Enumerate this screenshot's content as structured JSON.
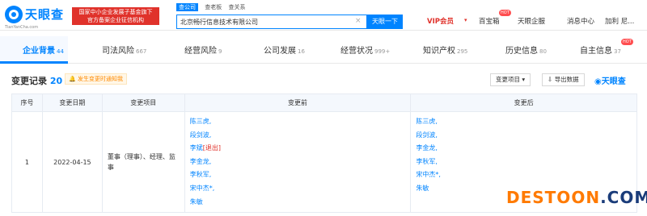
{
  "header": {
    "logo_text": "天眼查",
    "logo_sub": "TianYanCha.com",
    "banner_line1": "国家中小企业发展子基金旗下",
    "banner_line2": "官方备案企业征信机构",
    "search_tabs": [
      "查公司",
      "查老板",
      "查关系"
    ],
    "search_value": "北京畅行信息技术有限公司",
    "search_clear": "×",
    "search_button": "天眼一下",
    "nav_vip": "VIP会员",
    "nav_items": [
      "百宝箱",
      "天眼企服",
      "消息中心",
      "加利 尼..."
    ],
    "hot_badge": "HOT"
  },
  "tabs": [
    {
      "label": "企业背景",
      "count": "44"
    },
    {
      "label": "司法风险",
      "count": "667"
    },
    {
      "label": "经营风险",
      "count": "9"
    },
    {
      "label": "公司发展",
      "count": "16"
    },
    {
      "label": "经营状况",
      "count": "999+"
    },
    {
      "label": "知识产权",
      "count": "295"
    },
    {
      "label": "历史信息",
      "count": "80"
    },
    {
      "label": "自主信息",
      "count": "37"
    }
  ],
  "section": {
    "title": "变更记录",
    "count": "20",
    "notify": "发生变更时通知我",
    "filter_button": "变更项目 ▾",
    "export_button": "导出数据",
    "brand_mini": "天眼查"
  },
  "table": {
    "headers": [
      "序号",
      "变更日期",
      "变更项目",
      "变更前",
      "变更后"
    ],
    "row": {
      "index": "1",
      "date": "2022-04-15",
      "item": "董事（理事）、经理、监事",
      "before": [
        "陈三虎,",
        "段剑波,",
        "李斌",
        "[退出]",
        "李金龙,",
        "李秋军,",
        "宋中杰*,",
        "朱敏"
      ],
      "after": [
        "陈三虎,",
        "段剑波,",
        "李金龙,",
        "李秋军,",
        "宋中杰*,",
        "朱敏"
      ]
    }
  },
  "watermark": {
    "part1": "DESTOON",
    "part2": ".COM"
  }
}
